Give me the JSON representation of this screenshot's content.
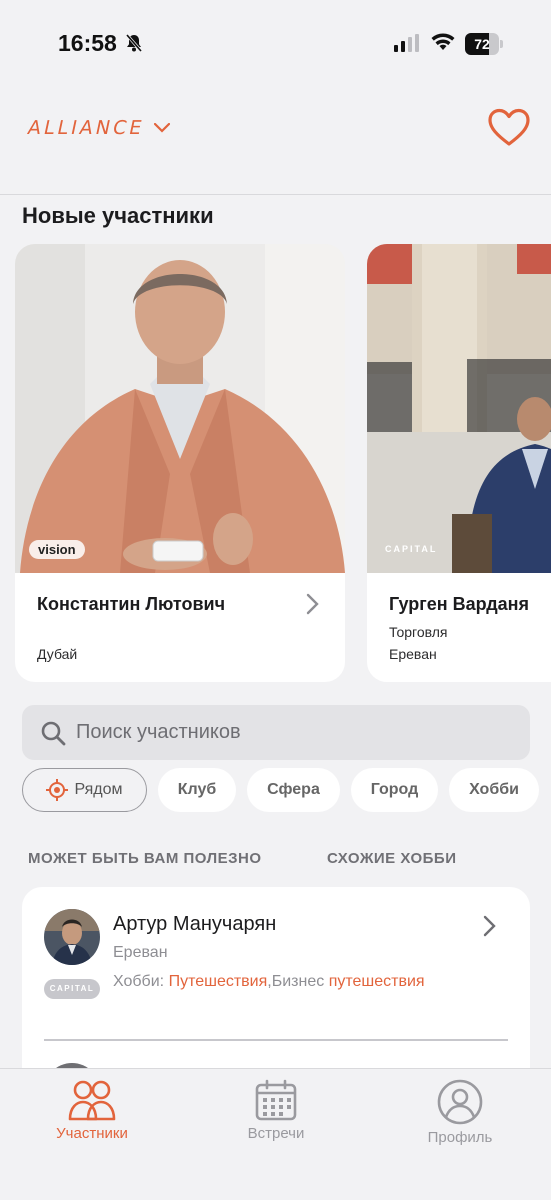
{
  "status_bar": {
    "time": "16:58",
    "battery": "72",
    "battery_level": 0.72
  },
  "header": {
    "brand": "ALLIANCE"
  },
  "new_members": {
    "title": "Новые участники",
    "cards": [
      {
        "name": "Константин Лютович",
        "line1": "Дубай",
        "badge": "vision"
      },
      {
        "name": "Гурген Варданя",
        "line1": "Торговля",
        "line2": "Ереван",
        "badge": "CAPITAL"
      }
    ]
  },
  "search": {
    "placeholder": "Поиск участников"
  },
  "filters": [
    "Рядом",
    "Клуб",
    "Сфера",
    "Город",
    "Хобби"
  ],
  "tabs": [
    "МОЖЕТ БЫТЬ ВАМ ПОЛЕЗНО",
    "СХОЖИЕ ХОББИ"
  ],
  "member": {
    "name": "Артур Манучарян",
    "city": "Ереван",
    "hobby_label": "Хобби:",
    "hobby_highlight": "Путешествия",
    "hobby_rest": ",Бизнес",
    "hobby_highlight2": "путешествия",
    "badge": "CAPITAL"
  },
  "tabbar": {
    "participants": "Участники",
    "meetings": "Встречи",
    "profile": "Профиль"
  },
  "colors": {
    "accent": "#e2643c",
    "inactive": "#9a9a9f",
    "background": "#f2f2f4"
  }
}
